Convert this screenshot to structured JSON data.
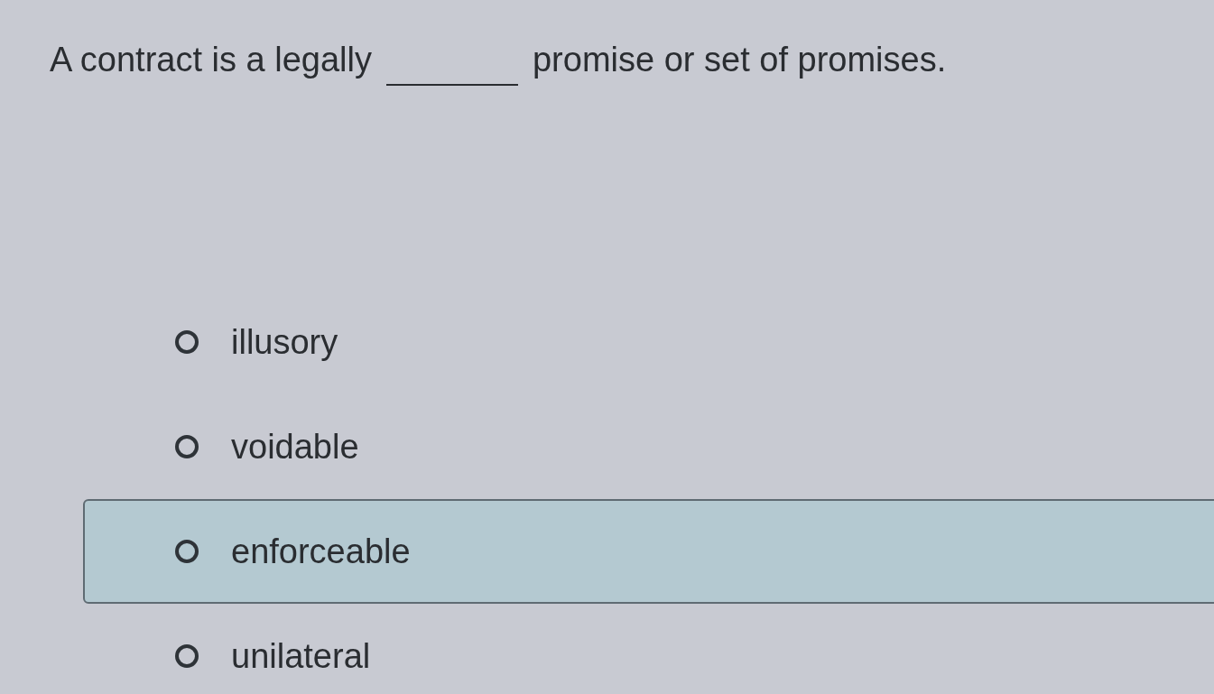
{
  "question": {
    "before": "A contract is a legally",
    "after": "promise or set of promises."
  },
  "options": [
    {
      "label": "illusory",
      "selected": false
    },
    {
      "label": "voidable",
      "selected": false
    },
    {
      "label": "enforceable",
      "selected": true
    },
    {
      "label": "unilateral",
      "selected": false
    }
  ]
}
